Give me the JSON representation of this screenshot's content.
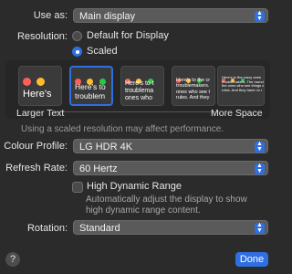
{
  "use_as": {
    "label": "Use as:",
    "value": "Main display"
  },
  "resolution": {
    "label": "Resolution:",
    "options": [
      "Default for Display",
      "Scaled"
    ],
    "selected": "Scaled"
  },
  "scaled_tiles": [
    {
      "preview_text": "Here's"
    },
    {
      "preview_text": "Here's to troublem",
      "selected": true
    },
    {
      "preview_text": "Here's to t troublema ones who"
    },
    {
      "preview_text": "Here's to the cr troublemakers. ones who see t rules. And they"
    },
    {
      "preview_text": "Here's to the crazy ones troublemakers. The round the ones who see things d rules. And they have no r"
    }
  ],
  "slider": {
    "left_label": "Larger Text",
    "right_label": "More Space"
  },
  "scaled_note": "Using a scaled resolution may affect performance.",
  "colour_profile": {
    "label": "Colour Profile:",
    "value": "LG HDR 4K"
  },
  "refresh_rate": {
    "label": "Refresh Rate:",
    "value": "60 Hertz"
  },
  "hdr": {
    "label": "High Dynamic Range",
    "checked": false,
    "description": "Automatically adjust the display to show high dynamic range content."
  },
  "rotation": {
    "label": "Rotation:",
    "value": "Standard"
  },
  "footer": {
    "help": "?",
    "done": "Done"
  },
  "colors": {
    "accent": "#2f6fe0",
    "red": "#ff5f57",
    "yellow": "#febc2e",
    "green": "#28c840"
  }
}
